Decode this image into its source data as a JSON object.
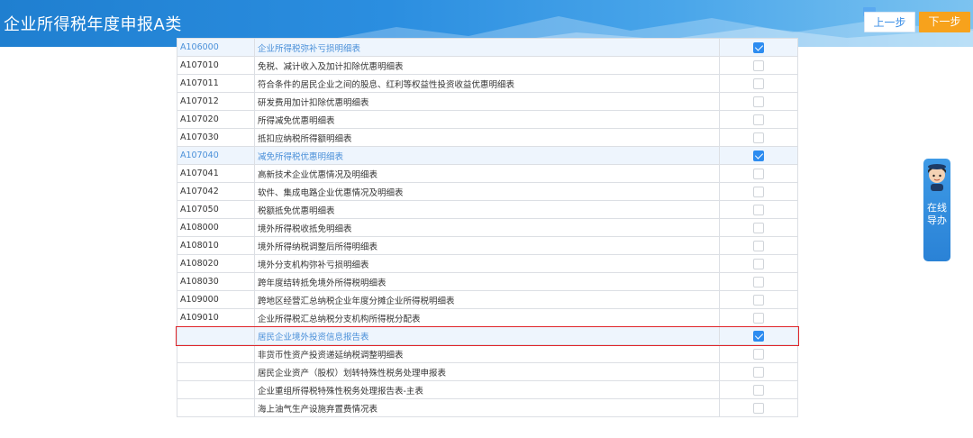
{
  "header": {
    "title": "企业所得税年度申报A类",
    "prev_label": "上一步",
    "next_label": "下一步"
  },
  "table": {
    "rows": [
      {
        "code": "A106000",
        "name": "企业所得税弥补亏损明细表",
        "checked": true,
        "selected": true
      },
      {
        "code": "A107010",
        "name": "免税、减计收入及加计扣除优惠明细表",
        "checked": false,
        "selected": false
      },
      {
        "code": "A107011",
        "name": "符合条件的居民企业之间的股息、红利等权益性投资收益优惠明细表",
        "checked": false,
        "selected": false
      },
      {
        "code": "A107012",
        "name": "研发费用加计扣除优惠明细表",
        "checked": false,
        "selected": false
      },
      {
        "code": "A107020",
        "name": "所得减免优惠明细表",
        "checked": false,
        "selected": false
      },
      {
        "code": "A107030",
        "name": "抵扣应纳税所得额明细表",
        "checked": false,
        "selected": false
      },
      {
        "code": "A107040",
        "name": "减免所得税优惠明细表",
        "checked": true,
        "selected": true
      },
      {
        "code": "A107041",
        "name": "高新技术企业优惠情况及明细表",
        "checked": false,
        "selected": false
      },
      {
        "code": "A107042",
        "name": "软件、集成电路企业优惠情况及明细表",
        "checked": false,
        "selected": false
      },
      {
        "code": "A107050",
        "name": "税额抵免优惠明细表",
        "checked": false,
        "selected": false
      },
      {
        "code": "A108000",
        "name": "境外所得税收抵免明细表",
        "checked": false,
        "selected": false
      },
      {
        "code": "A108010",
        "name": "境外所得纳税调整后所得明细表",
        "checked": false,
        "selected": false
      },
      {
        "code": "A108020",
        "name": "境外分支机构弥补亏损明细表",
        "checked": false,
        "selected": false
      },
      {
        "code": "A108030",
        "name": "跨年度结转抵免境外所得税明细表",
        "checked": false,
        "selected": false
      },
      {
        "code": "A109000",
        "name": "跨地区经营汇总纳税企业年度分摊企业所得税明细表",
        "checked": false,
        "selected": false
      },
      {
        "code": "A109010",
        "name": "企业所得税汇总纳税分支机构所得税分配表",
        "checked": false,
        "selected": false
      },
      {
        "code": "",
        "name": "居民企业境外投资信息报告表",
        "checked": true,
        "selected": true
      },
      {
        "code": "",
        "name": "非货币性资产投资递延纳税调整明细表",
        "checked": false,
        "selected": false
      },
      {
        "code": "",
        "name": "居民企业资产（股权）划转特殊性税务处理申报表",
        "checked": false,
        "selected": false
      },
      {
        "code": "",
        "name": "企业重组所得税特殊性税务处理报告表-主表",
        "checked": false,
        "selected": false
      },
      {
        "code": "",
        "name": "海上油气生产设施弃置费情况表",
        "checked": false,
        "selected": false
      }
    ]
  },
  "guide": {
    "label": "在线导办"
  },
  "colors": {
    "header": "#2b8ee0",
    "next_button": "#f7a21c",
    "highlight": "#e0242a",
    "checkbox_on": "#2d8cf0"
  }
}
